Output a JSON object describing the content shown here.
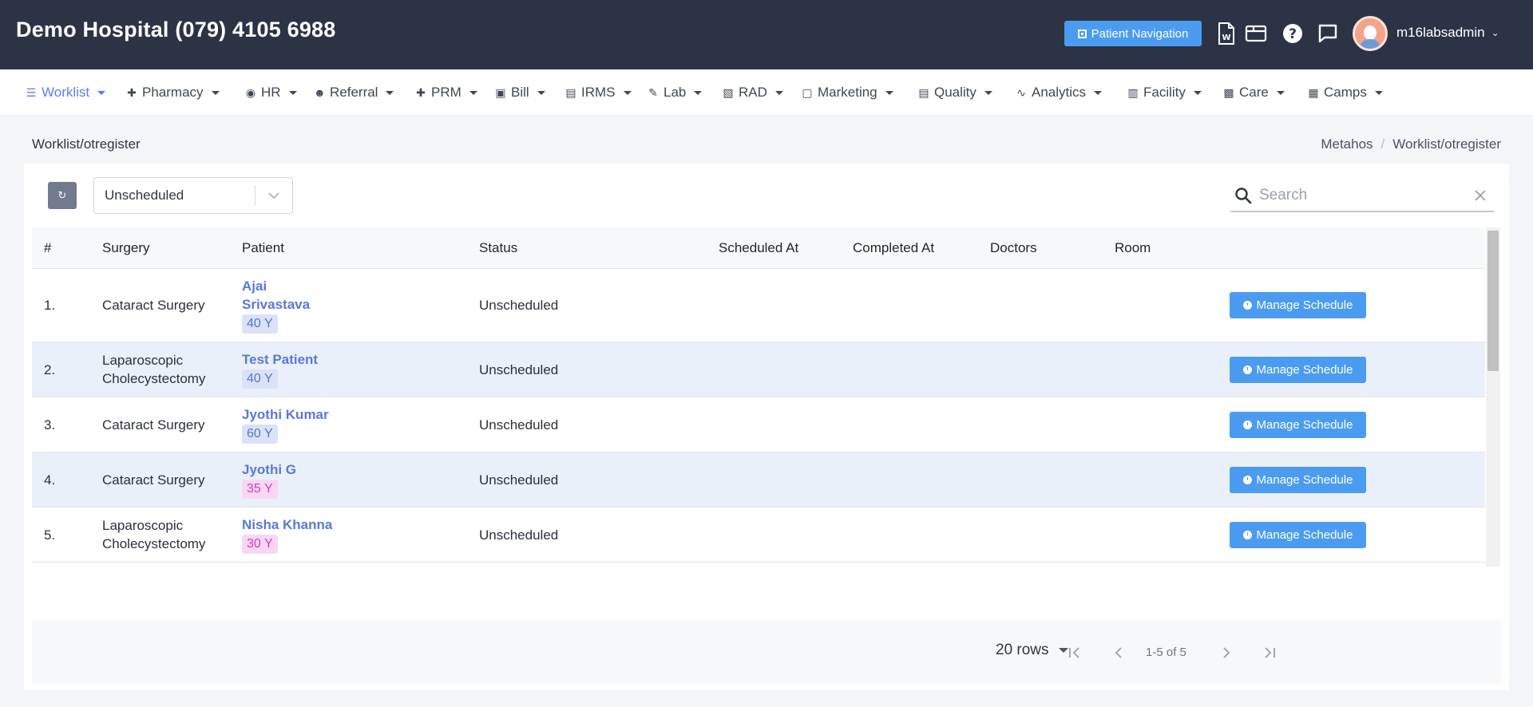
{
  "header": {
    "hospital_title": "Demo Hospital (079) 4105 6988",
    "patient_navigation_label": "Patient Navigation",
    "username": "m16labsadmin"
  },
  "nav": {
    "items": [
      {
        "label": "Worklist",
        "icon": "list-icon",
        "active": true
      },
      {
        "label": "Pharmacy",
        "icon": "plus-icon"
      },
      {
        "label": "HR",
        "icon": "user-circle-icon"
      },
      {
        "label": "Referral",
        "icon": "users-icon"
      },
      {
        "label": "PRM",
        "icon": "plus-icon"
      },
      {
        "label": "Bill",
        "icon": "money-icon"
      },
      {
        "label": "IRMS",
        "icon": "id-card-icon"
      },
      {
        "label": "Lab",
        "icon": "pencil-icon"
      },
      {
        "label": "RAD",
        "icon": "film-icon"
      },
      {
        "label": "Marketing",
        "icon": "shopping-bag-icon"
      },
      {
        "label": "Quality",
        "icon": "id-card-icon"
      },
      {
        "label": "Analytics",
        "icon": "pulse-icon"
      },
      {
        "label": "Facility",
        "icon": "building-icon"
      },
      {
        "label": "Care",
        "icon": "bed-icon"
      },
      {
        "label": "Camps",
        "icon": "briefcase-icon"
      }
    ]
  },
  "page": {
    "heading": "Worklist/otregister",
    "breadcrumb": [
      "Metahos",
      "Worklist/otregister"
    ]
  },
  "filters": {
    "status_value": "Unscheduled",
    "search_placeholder": "Search"
  },
  "table": {
    "columns": [
      "#",
      "Surgery",
      "Patient",
      "Status",
      "Scheduled At",
      "Completed At",
      "Doctors",
      "Room"
    ],
    "action_label": "Manage Schedule",
    "rows": [
      {
        "index": "1.",
        "surgery": "Cataract Surgery",
        "patient": "Ajai Srivastava",
        "age": "40 Y",
        "gender": "male",
        "status": "Unscheduled",
        "scheduled_at": "",
        "completed_at": "",
        "doctors": "",
        "room": ""
      },
      {
        "index": "2.",
        "surgery": "Laparoscopic Cholecystectomy",
        "patient": "Test Patient",
        "age": "40 Y",
        "gender": "male",
        "status": "Unscheduled",
        "scheduled_at": "",
        "completed_at": "",
        "doctors": "",
        "room": ""
      },
      {
        "index": "3.",
        "surgery": "Cataract Surgery",
        "patient": "Jyothi Kumar",
        "age": "60 Y",
        "gender": "male",
        "status": "Unscheduled",
        "scheduled_at": "",
        "completed_at": "",
        "doctors": "",
        "room": ""
      },
      {
        "index": "4.",
        "surgery": "Cataract Surgery",
        "patient": "Jyothi G",
        "age": "35 Y",
        "gender": "female",
        "status": "Unscheduled",
        "scheduled_at": "",
        "completed_at": "",
        "doctors": "",
        "room": ""
      },
      {
        "index": "5.",
        "surgery": "Laparoscopic Cholecystectomy",
        "patient": "Nisha Khanna",
        "age": "30 Y",
        "gender": "female",
        "status": "Unscheduled",
        "scheduled_at": "",
        "completed_at": "",
        "doctors": "",
        "room": ""
      }
    ]
  },
  "pagination": {
    "rows_per_page": "20 rows",
    "range_text": "1-5 of 5"
  },
  "colors": {
    "header_bg": "#2c3345",
    "accent_blue": "#4b9cf0",
    "link_blue": "#5a78d6",
    "female_badge": "#d53ac0"
  }
}
